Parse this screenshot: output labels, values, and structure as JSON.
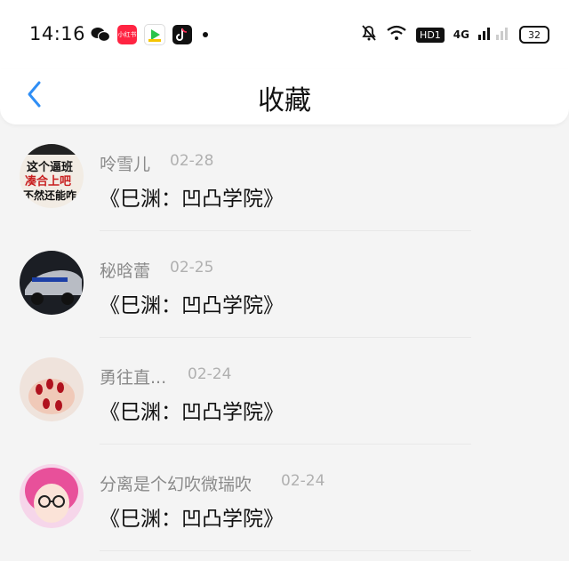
{
  "status_bar": {
    "time": "14:16",
    "network": "4G",
    "hd": "HD1",
    "battery": "32",
    "xhs_label": "小红书"
  },
  "nav": {
    "title": "收藏"
  },
  "items": [
    {
      "username": "呤雪儿",
      "date": "02-28",
      "title": "《巳渊：凹凸学院》",
      "avatar_text": "这个逼班\n凑合上吧\n不然还能咋"
    },
    {
      "username": "秘晗蕾",
      "date": "02-25",
      "title": "《巳渊：凹凸学院》"
    },
    {
      "username": "勇往直...",
      "date": "02-24",
      "title": "《巳渊：凹凸学院》"
    },
    {
      "username": "分离是个幻吹微瑞吹",
      "date": "02-24",
      "title": "《巳渊：凹凸学院》"
    }
  ]
}
